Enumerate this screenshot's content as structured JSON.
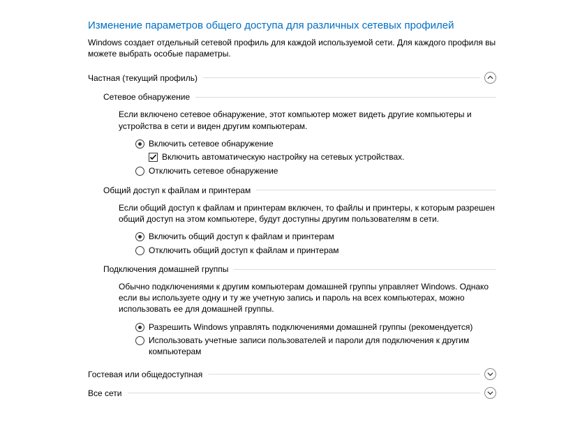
{
  "title": "Изменение параметров общего доступа для различных сетевых профилей",
  "intro": "Windows создает отдельный сетевой профиль для каждой используемой сети. Для каждого профиля вы можете выбрать особые параметры.",
  "profile_private": {
    "header": "Частная (текущий профиль)",
    "network_discovery": {
      "header": "Сетевое обнаружение",
      "desc": "Если включено сетевое обнаружение, этот компьютер может видеть другие компьютеры и устройства в сети и виден другим компьютерам.",
      "opt_on": "Включить сетевое обнаружение",
      "opt_auto": "Включить автоматическую настройку на сетевых устройствах.",
      "opt_off": "Отключить сетевое обнаружение"
    },
    "file_sharing": {
      "header": "Общий доступ к файлам и принтерам",
      "desc": "Если общий доступ к файлам и принтерам включен, то файлы и принтеры, к которым разрешен общий доступ на этом компьютере, будут доступны другим пользователям в сети.",
      "opt_on": "Включить общий доступ к файлам и принтерам",
      "opt_off": "Отключить общий доступ к файлам и принтерам"
    },
    "homegroup": {
      "header": "Подключения домашней группы",
      "desc": "Обычно подключениями к другим компьютерам домашней группы управляет Windows. Однако если вы используете одну и ту же учетную запись и пароль на всех компьютерах, можно использовать ее для домашней группы.",
      "opt_win": "Разрешить Windows управлять подключениями домашней группы (рекомендуется)",
      "opt_user": "Использовать учетные записи пользователей и пароли для подключения к другим компьютерам"
    }
  },
  "profile_guest": {
    "header": "Гостевая или общедоступная"
  },
  "profile_all": {
    "header": "Все сети"
  }
}
